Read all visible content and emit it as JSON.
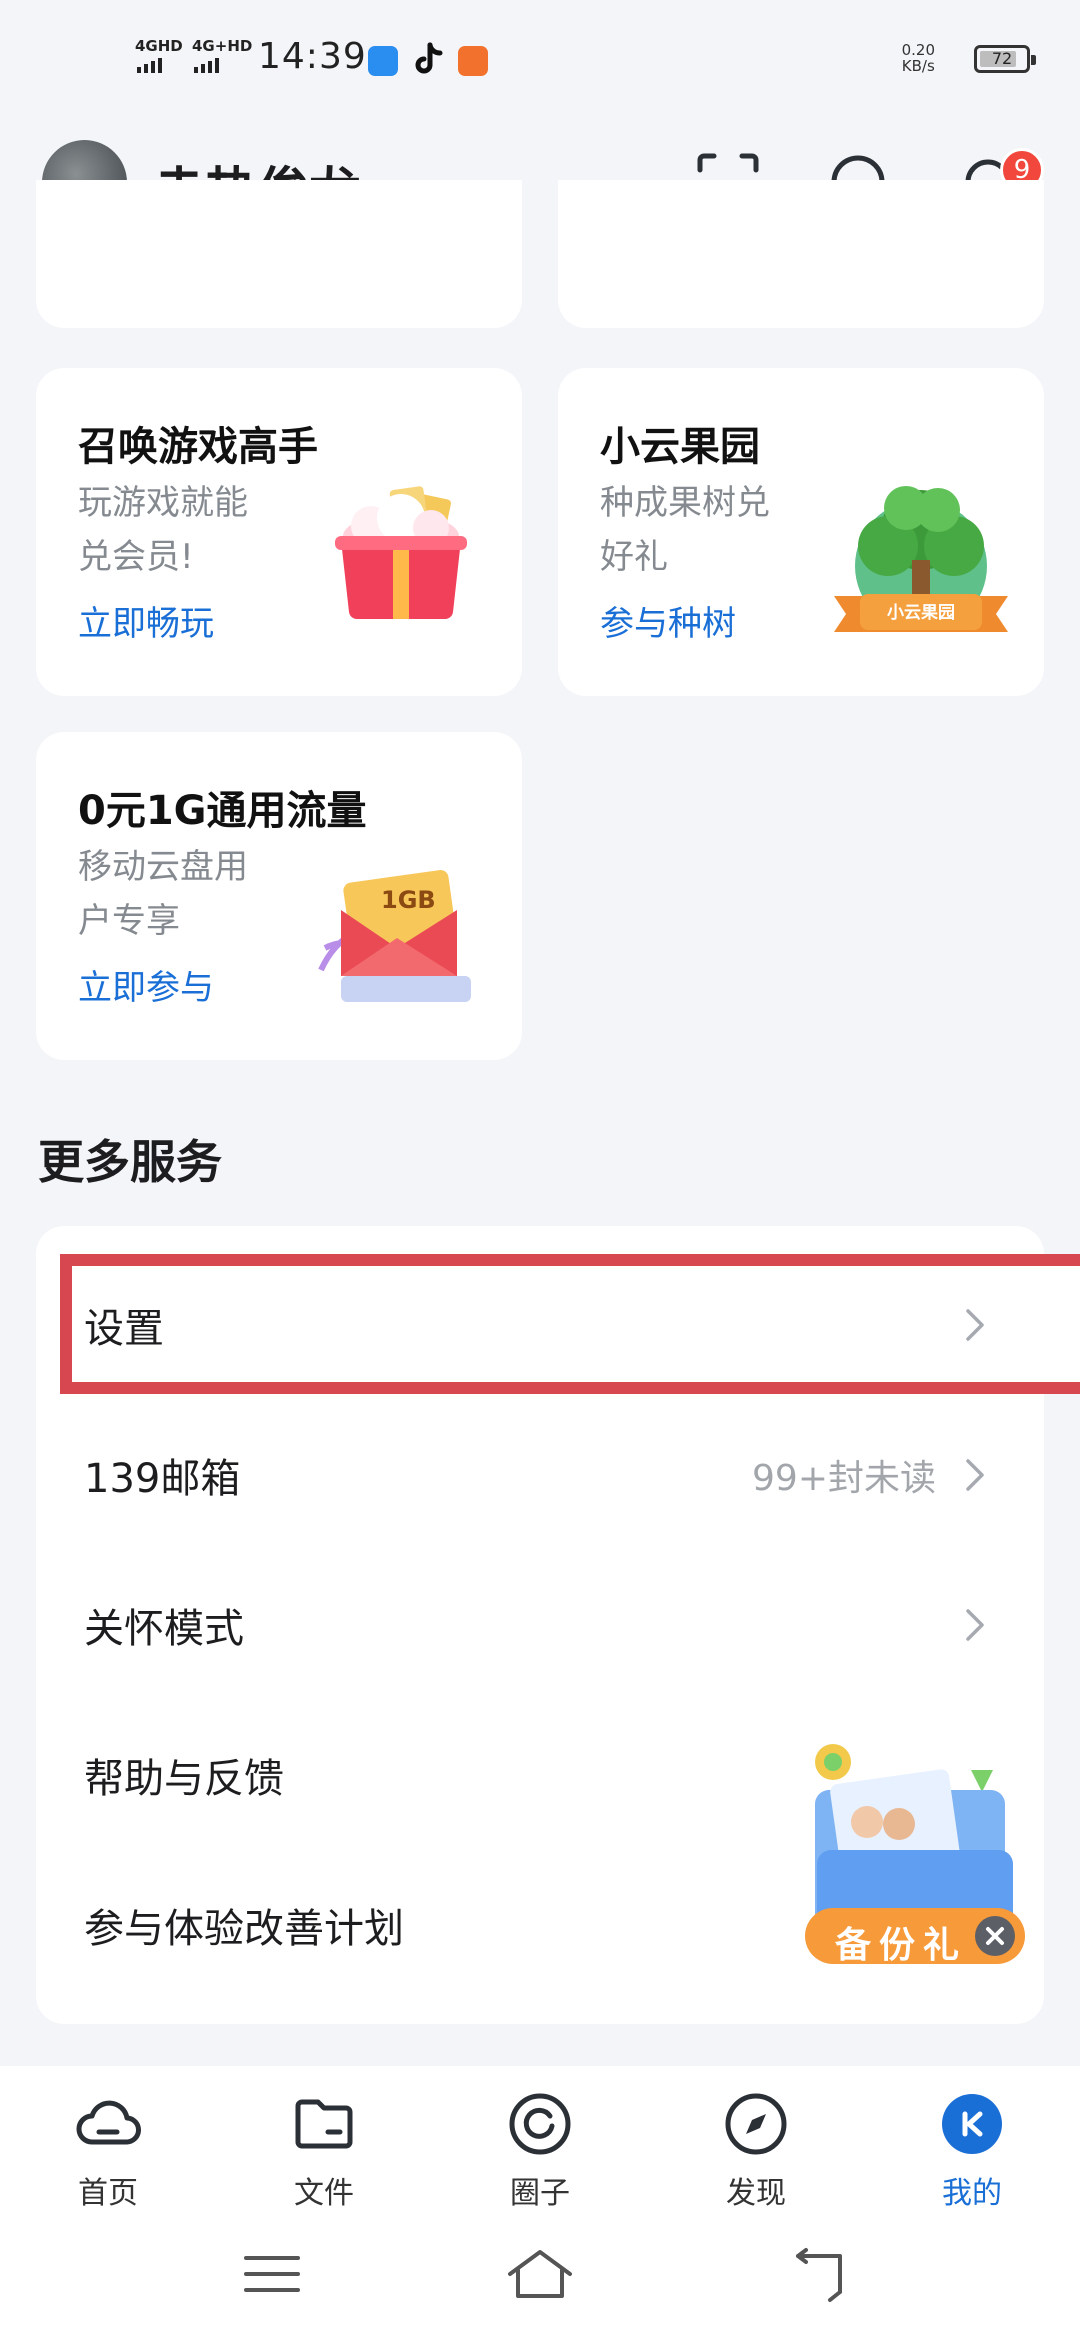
{
  "status_bar": {
    "signal1": "4GHD",
    "signal2": "4G+HD",
    "time": "14:39",
    "net_speed_value": "0.20",
    "net_speed_unit": "KB/s",
    "battery": "72"
  },
  "header": {
    "username": "赤热俊龙",
    "notification_count": "9"
  },
  "cards": [
    {
      "title": "召唤游戏高手",
      "desc": "玩游戏就能兑会员!",
      "link": "立即畅玩"
    },
    {
      "title": "小云果园",
      "desc": "种成果树兑好礼",
      "link": "参与种树",
      "image_text": "小云果园"
    },
    {
      "title": "0元1G通用流量",
      "desc": "移动云盘用户专享",
      "link": "立即参与",
      "image_text": "1GB"
    }
  ],
  "more_services": {
    "title": "更多服务",
    "items": [
      {
        "label": "设置",
        "extra": ""
      },
      {
        "label": "139邮箱",
        "extra": "99+封未读"
      },
      {
        "label": "关怀模式",
        "extra": ""
      },
      {
        "label": "帮助与反馈",
        "extra": ""
      },
      {
        "label": "参与体验改善计划",
        "extra": ""
      }
    ]
  },
  "promo": {
    "label": "备份礼"
  },
  "tabs": [
    {
      "label": "首页",
      "icon": "cloud-icon"
    },
    {
      "label": "文件",
      "icon": "folder-icon"
    },
    {
      "label": "圈子",
      "icon": "circle-icon"
    },
    {
      "label": "发现",
      "icon": "compass-icon"
    },
    {
      "label": "我的",
      "icon": "me-icon",
      "active": true
    }
  ],
  "colors": {
    "accent": "#1a6fd6",
    "badge": "#f2473d",
    "highlight_border": "#d6474f",
    "background": "#f3f5f8"
  }
}
